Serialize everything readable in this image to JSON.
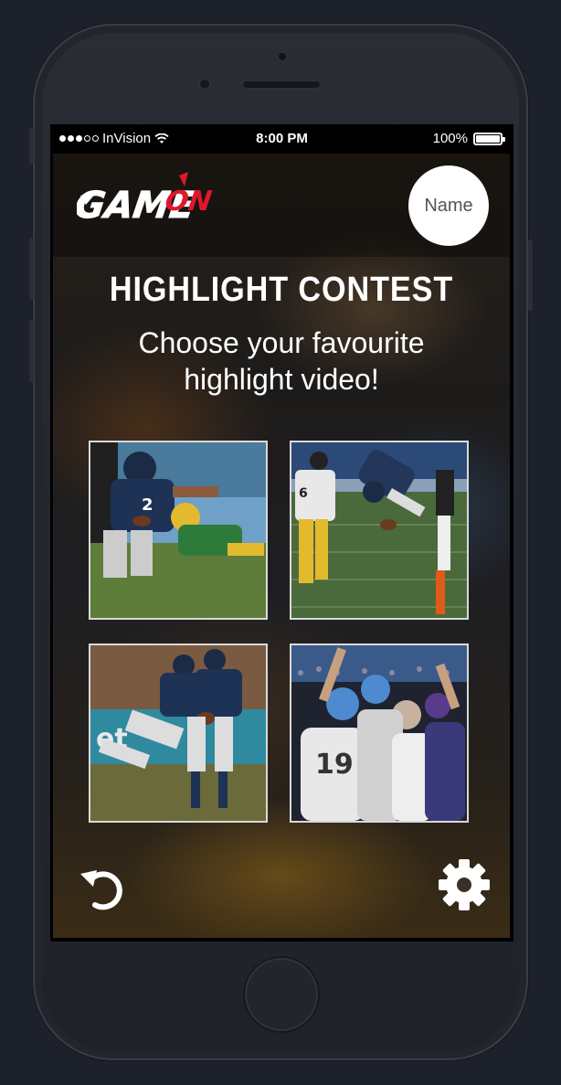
{
  "status_bar": {
    "carrier": "InVision",
    "time": "8:00 PM",
    "battery": "100%"
  },
  "header": {
    "logo_text": "GameOn",
    "avatar_label": "Name"
  },
  "main": {
    "title": "HIGHLIGHT CONTEST",
    "subtitle_line1": "Choose your favourite",
    "subtitle_line2": "highlight video!"
  },
  "videos": [
    {
      "thumbnail": "football-tackle-thumbnail"
    },
    {
      "thumbnail": "diving-catch-thumbnail"
    },
    {
      "thumbnail": "handoff-play-thumbnail"
    },
    {
      "thumbnail": "fans-cheering-thumbnail"
    }
  ],
  "footer": {
    "undo_icon": "undo-icon",
    "settings_icon": "gear-icon"
  },
  "colors": {
    "logo_red": "#e0182d",
    "text_white": "#ffffff",
    "tile_border": "#d9d9d9"
  }
}
